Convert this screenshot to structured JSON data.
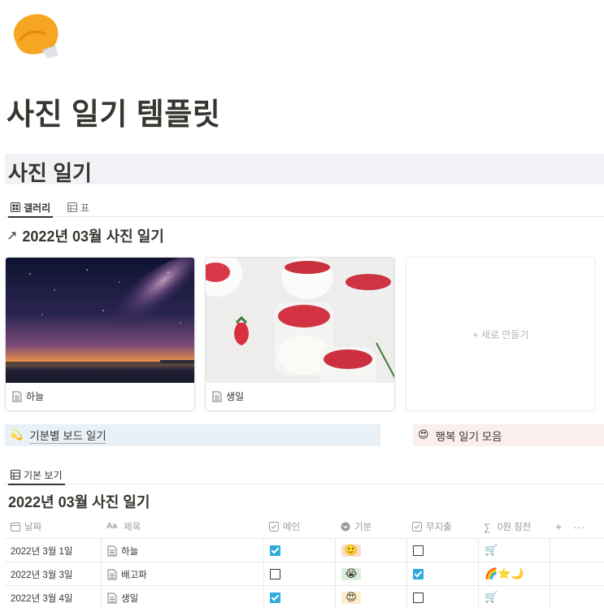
{
  "page": {
    "title": "사진 일기 템플릿",
    "icon": "fortune-cookie-icon"
  },
  "database": {
    "title": "사진 일기",
    "views": [
      {
        "label": "갤러리",
        "icon": "gallery-icon",
        "active": true
      },
      {
        "label": "표",
        "icon": "table-icon",
        "active": false
      }
    ]
  },
  "gallery": {
    "heading": "2022년 03월 사진 일기",
    "heading_icon": "arrow-northeast-icon",
    "cards": [
      {
        "title": "하늘",
        "cover": "night-sky-milky-way"
      },
      {
        "title": "생일",
        "cover": "strawberry-panna-cotta"
      }
    ],
    "new_label": "+ 새로 만들기"
  },
  "callouts": [
    {
      "emoji": "💫",
      "text": "기분별 보드 일기",
      "color": "#e8f1f8"
    },
    {
      "emoji": "😍",
      "text": "행복 일기 모음",
      "color": "#fbeeee"
    }
  ],
  "table_view": {
    "tab_label": "기본 보기",
    "heading": "2022년 03월 사진 일기",
    "columns": [
      {
        "label": "날짜",
        "icon": "calendar-icon"
      },
      {
        "label": "제목",
        "icon": "text-aa-icon"
      },
      {
        "label": "메인",
        "icon": "checkbox-icon"
      },
      {
        "label": "기분",
        "icon": "select-icon"
      },
      {
        "label": "무지출",
        "icon": "checkbox-icon"
      },
      {
        "label": "0원 칭찬",
        "icon": "sigma-icon"
      }
    ],
    "add_column_label": "+",
    "more_label": "···",
    "rows": [
      {
        "date": "2022년 3월 1일",
        "title": "하늘",
        "main": true,
        "mood": "🙂",
        "mood_color": "#fadec9",
        "no_spend": false,
        "praise": "🛒"
      },
      {
        "date": "2022년 3월 3일",
        "title": "배고파",
        "main": false,
        "mood": "😭",
        "mood_color": "#dbeddb",
        "no_spend": true,
        "praise": "🌈⭐🌙"
      },
      {
        "date": "2022년 3월 4일",
        "title": "생일",
        "main": true,
        "mood": "😍",
        "mood_color": "#fdecc8",
        "no_spend": false,
        "praise": "🛒"
      }
    ]
  },
  "colors": {
    "accent_checkbox": "#2eaadc",
    "header_band": "#f3f1f6"
  }
}
